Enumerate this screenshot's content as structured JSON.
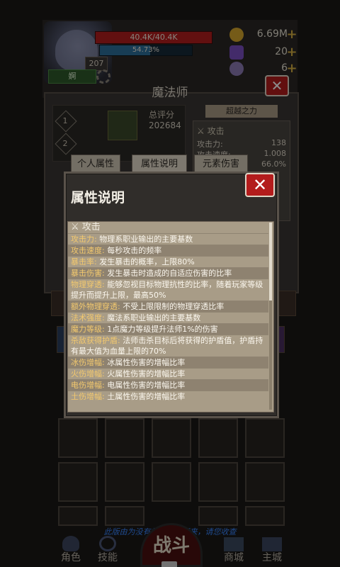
{
  "hud": {
    "hp_text": "40.4K/40.4K",
    "mp_text": "54.73%",
    "mp_fraction": 0.5473,
    "level": "207",
    "player_name": "婀",
    "resources": [
      {
        "icon": "gold-coin-icon",
        "value": "6.69M",
        "plus": "+",
        "color": "#d6a72c"
      },
      {
        "icon": "purple-gem-icon",
        "value": "20",
        "plus": "+",
        "color": "#7a4fc2"
      },
      {
        "icon": "spiral-shell-icon",
        "value": "6",
        "plus": "+",
        "color": "#8d7ab5"
      }
    ],
    "close_glyph": "✕"
  },
  "character": {
    "class_title": "魔法师",
    "score_label": "总评分",
    "score_value": "202684",
    "diamond_1": "1",
    "diamond_2": "2",
    "ribbon_label": "超越之力"
  },
  "attack_panel": {
    "head": "⚔ 攻击",
    "rows": [
      {
        "label": "攻击力:",
        "value": "138"
      },
      {
        "label": "攻击速度:",
        "value": "1.008"
      },
      {
        "label": "",
        "value": "66.0%"
      }
    ]
  },
  "tabs": [
    {
      "label": "个人属性"
    },
    {
      "label": "属性说明"
    },
    {
      "label": "元素伤害"
    }
  ],
  "modal": {
    "title": "属性说明",
    "close_glyph": "✕",
    "section_head": "⚔ 攻击",
    "rows": [
      {
        "key": "攻击力:",
        "text": " 物理系职业输出的主要基数"
      },
      {
        "key": "攻击速度:",
        "text": " 每秒攻击的频率"
      },
      {
        "key": "暴击率:",
        "text": " 发生暴击的概率，上限80%"
      },
      {
        "key": "暴击伤害:",
        "text": " 发生暴击时造成的自适应伤害的比率"
      },
      {
        "key": "物理穿透:",
        "text": " 能够忽视目标物理抗性的比率，随着玩家等级提升而提升上限，最高50%"
      },
      {
        "key": "额外物理穿透:",
        "text": " 不受上限限制的物理穿透比率"
      },
      {
        "key": "法术强度:",
        "text": " 魔法系职业输出的主要基数"
      },
      {
        "key": "魔力等级:",
        "text": " 1点魔力等级提升法师1%的伤害"
      },
      {
        "key": "杀敌获得护盾:",
        "text": " 法师击杀目标后将获得的护盾值，护盾持有最大值为血量上限的70%"
      },
      {
        "key": "冰伤增幅:",
        "text": " 冰属性伤害的增幅比率"
      },
      {
        "key": "火伤增幅:",
        "text": " 火属性伤害的增幅比率"
      },
      {
        "key": "电伤增幅:",
        "text": " 电属性伤害的增幅比率"
      },
      {
        "key": "土伤增幅:",
        "text": " 土属性伤害的增幅比率"
      }
    ]
  },
  "notice": "此版由为没有规则的被再来，请您收查",
  "nav": {
    "role": "角色",
    "skill": "技能",
    "fight": "战斗",
    "shop": "商城",
    "city": "主城"
  }
}
